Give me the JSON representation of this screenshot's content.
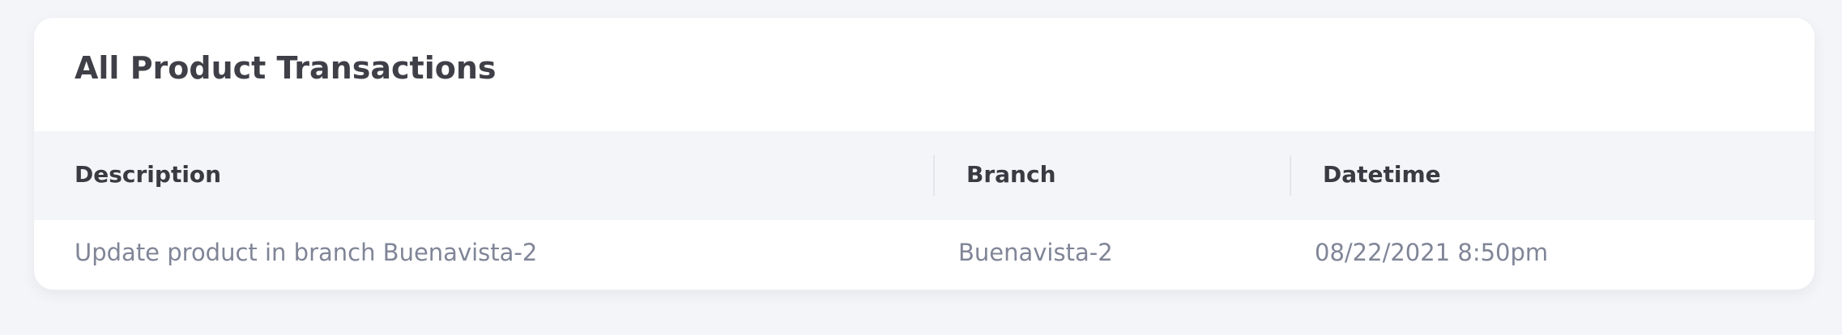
{
  "card": {
    "title": "All Product Transactions"
  },
  "table": {
    "columns": [
      "Description",
      "Branch",
      "Datetime"
    ],
    "rows": [
      {
        "description": "Update product in branch Buenavista-2",
        "branch": "Buenavista-2",
        "datetime": "08/22/2021 8:50pm"
      }
    ]
  }
}
